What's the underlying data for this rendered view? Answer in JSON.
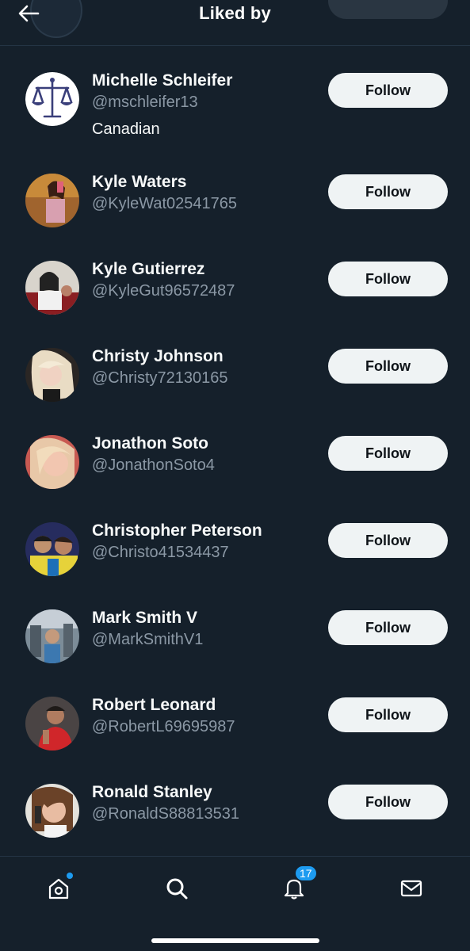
{
  "header": {
    "title": "Liked by"
  },
  "users": [
    {
      "name": "Michelle Schleifer",
      "handle": "@mschleifer13",
      "bio": "Canadian",
      "button": "Follow"
    },
    {
      "name": "Kyle Waters",
      "handle": "@KyleWat02541765",
      "button": "Follow"
    },
    {
      "name": "Kyle Gutierrez",
      "handle": "@KyleGut96572487",
      "button": "Follow"
    },
    {
      "name": "Christy Johnson",
      "handle": "@Christy72130165",
      "button": "Follow"
    },
    {
      "name": "Jonathon Soto",
      "handle": "@JonathonSoto4",
      "button": "Follow"
    },
    {
      "name": "Christopher Peterson",
      "handle": "@Christo41534437",
      "button": "Follow"
    },
    {
      "name": "Mark Smith V",
      "handle": "@MarkSmithV1",
      "button": "Follow"
    },
    {
      "name": "Robert Leonard",
      "handle": "@RobertL69695987",
      "button": "Follow"
    },
    {
      "name": "Ronald Stanley",
      "handle": "@RonaldS88813531",
      "button": "Follow"
    }
  ],
  "tabbar": {
    "tabs": [
      {
        "icon": "home-icon",
        "has_dot": true
      },
      {
        "icon": "search-icon"
      },
      {
        "icon": "notifications-icon",
        "badge": "17"
      },
      {
        "icon": "messages-icon"
      }
    ]
  },
  "colors": {
    "background": "#15202b",
    "accent": "#1d9bf0",
    "button_bg": "#eff3f4",
    "secondary_text": "#8b98a5"
  }
}
